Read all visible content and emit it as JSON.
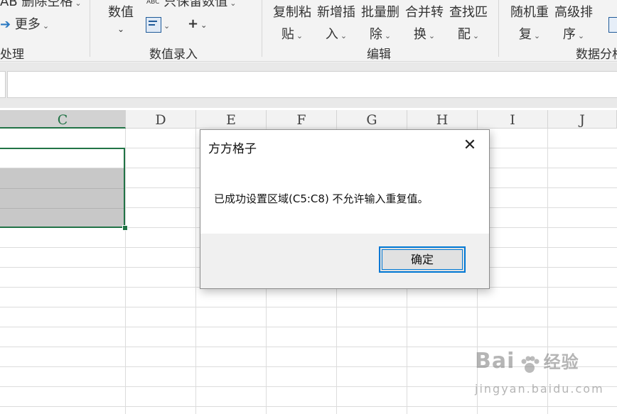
{
  "ribbon": {
    "top_left_1": "AB 删除空格",
    "top_left_2": "更多",
    "group_partial": "处理",
    "number_value": "数值",
    "abc_label": "ABC",
    "keep_values": "只保留数值",
    "plus": "+",
    "group_number_entry": "数值录入",
    "copy_paste": [
      "复制粘",
      "贴"
    ],
    "insert_new": [
      "新增插",
      "入"
    ],
    "batch_delete": [
      "批量删",
      "除"
    ],
    "merge_convert": [
      "合并转",
      "换"
    ],
    "find_match": [
      "查找匹",
      "配"
    ],
    "group_edit": "编辑",
    "random_repeat": [
      "随机重",
      "复"
    ],
    "advanced_sort": [
      "高级排",
      "序"
    ],
    "group_data_analysis": "数据分析",
    "chevron": "⌄"
  },
  "columns": [
    "C",
    "D",
    "E",
    "F",
    "G",
    "H",
    "I",
    "J"
  ],
  "dialog": {
    "title": "方方格子",
    "close": "✕",
    "message": "已成功设置区域(C5:C8) 不允许输入重复值。",
    "ok_button": "确定"
  },
  "watermark": {
    "logo": "Bai",
    "logo_tail": "经验",
    "url": "jingyan.baidu.com"
  },
  "colors": {
    "accent_green": "#217346",
    "button_blue": "#0078d4"
  }
}
